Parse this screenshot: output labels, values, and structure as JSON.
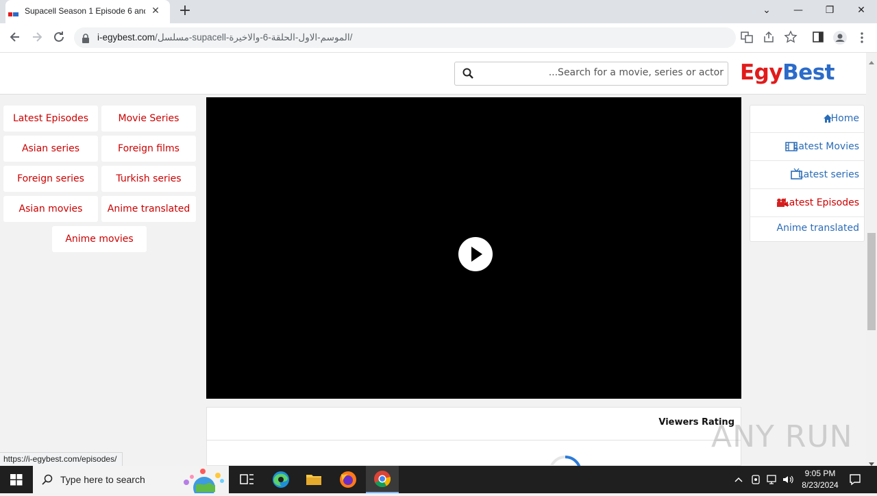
{
  "browser": {
    "tab_title": "Supacell Season 1 Episode 6 and",
    "url_host": "i-egybest.com",
    "url_path": "/مسلسل-supacell-الموسم-الاول-الحلقة-6-والاخيرة/",
    "status_link": "https://i-egybest.com/episodes/"
  },
  "site": {
    "search_placeholder": "...Search for a movie, series or actor",
    "logo_part1": "Egy",
    "logo_part2": "Best"
  },
  "categories": [
    {
      "label": "Latest Episodes"
    },
    {
      "label": "Movie Series"
    },
    {
      "label": "Asian series"
    },
    {
      "label": "Foreign films"
    },
    {
      "label": "Foreign series"
    },
    {
      "label": "Turkish series"
    },
    {
      "label": "Asian movies"
    },
    {
      "label": "Anime translated"
    },
    {
      "label": "Anime movies"
    }
  ],
  "right_nav": [
    {
      "label": "Home",
      "icon": "home-icon"
    },
    {
      "label": "Latest Movies",
      "icon": "film-icon"
    },
    {
      "label": "Latest series",
      "icon": "tv-icon"
    },
    {
      "label": "Latest Episodes",
      "icon": "camera-icon"
    },
    {
      "label": "Anime translated",
      "icon": ""
    }
  ],
  "rating": {
    "title": "Viewers Rating"
  },
  "watermark": "ANY RUN",
  "taskbar": {
    "search_placeholder": "Type here to search",
    "time": "9:05 PM",
    "date": "8/23/2024"
  },
  "colors": {
    "accent_red": "#cc0000",
    "link_blue": "#2a6cb8",
    "logo_red": "#e21b1b",
    "logo_blue": "#2b6bc9"
  }
}
